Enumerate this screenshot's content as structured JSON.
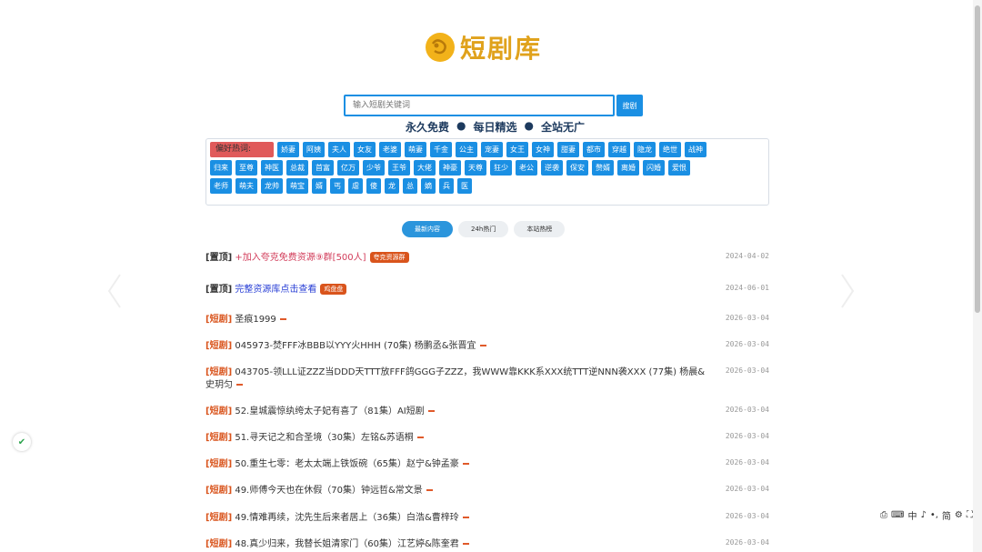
{
  "logo": {
    "text": "短剧库",
    "color": "#e0a21c"
  },
  "search": {
    "placeholder": "输入短剧关键词",
    "button_label": "搜剧"
  },
  "slogan": [
    "永久免费",
    "每日精选",
    "全站无广"
  ],
  "hot": {
    "title": "偏好热词:",
    "rows": [
      [
        "娇妻",
        "阿姨",
        "夫人",
        "女友",
        "老婆",
        "萌妻",
        "千金",
        "公主",
        "宠妻",
        "女王",
        "女神",
        "甜妻",
        "都市",
        "穿越",
        "隐龙",
        "绝世",
        "战神"
      ],
      [
        "归来",
        "至尊",
        "神医",
        "总裁",
        "首富",
        "亿万",
        "少爷",
        "王爷",
        "大佬",
        "神豪",
        "天尊",
        "狂少",
        "老公",
        "逆袭",
        "保安",
        "赘婿",
        "离婚",
        "闪婚",
        "爱恨"
      ],
      [
        "老师",
        "萌夫",
        "龙帅",
        "萌宝",
        "婿",
        "丐",
        "虐",
        "傻",
        "龙",
        "总",
        "嫡",
        "兵",
        "医"
      ]
    ]
  },
  "tabs": [
    {
      "label": "最新内容",
      "active": true
    },
    {
      "label": "24h热门",
      "active": false
    },
    {
      "label": "本站热榜",
      "active": false
    }
  ],
  "list": [
    {
      "cat": "[置顶]",
      "cat_type": "top",
      "title": "+加入夸克免费资源⑨群[500人]",
      "style": "pink",
      "badge": "夸克资源群",
      "date": "2024-04-02"
    },
    {
      "cat": "[置顶]",
      "cat_type": "top",
      "title": "完整资源库点击查看",
      "style": "blue",
      "badge": "鸡盘盘",
      "date": "2024-06-01"
    },
    {
      "cat": "[短剧]",
      "cat_type": "short",
      "title": "圣痕1999",
      "date": "2026-03-04"
    },
    {
      "cat": "[短剧]",
      "cat_type": "short",
      "title": "045973-焚FFF冰BBB以YYY火HHH (70集) 杨鹏丞&张晋宜",
      "date": "2026-03-04"
    },
    {
      "cat": "[短剧]",
      "cat_type": "short",
      "title": "043705-领LLL证ZZZ当DDD天TTT放FFF鸽GGG子ZZZ，我WWW靠KKK系XXX统TTT逆NNN袭XXX (77集) 杨晨&史玥匀",
      "date": "2026-03-04"
    },
    {
      "cat": "[短剧]",
      "cat_type": "short",
      "title": "52.皇城震惊纨绔太子妃有喜了（81集）AI短剧",
      "date": "2026-03-04"
    },
    {
      "cat": "[短剧]",
      "cat_type": "short",
      "title": "51.寻天记之和合圣境（30集）左铭&苏语桐",
      "date": "2026-03-04"
    },
    {
      "cat": "[短剧]",
      "cat_type": "short",
      "title": "50.重生七零：老太太端上铁饭碗（65集）赵宁&钟孟豪",
      "date": "2026-03-04"
    },
    {
      "cat": "[短剧]",
      "cat_type": "short",
      "title": "49.师傅今天也在休假（70集）钟远哲&常文景",
      "date": "2026-03-04"
    },
    {
      "cat": "[短剧]",
      "cat_type": "short",
      "title": "49.情难再续，沈先生后来者居上（36集）白浩&曹梓玲",
      "date": "2026-03-04"
    },
    {
      "cat": "[短剧]",
      "cat_type": "short",
      "title": "48.真少归来，我替长姐清家门（60集）江艺婷&陈奎君",
      "date": "2026-03-04"
    }
  ],
  "ime": [
    "中",
    "♪",
    "•,",
    "简"
  ]
}
